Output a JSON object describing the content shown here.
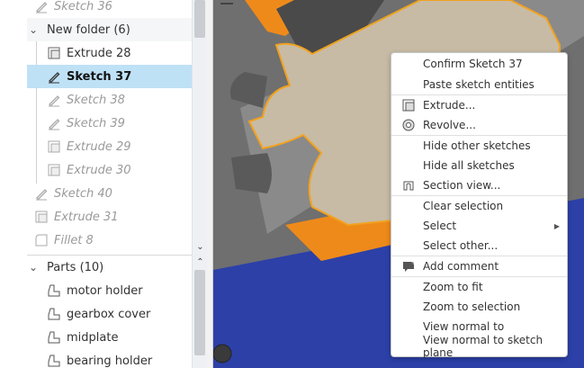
{
  "tree": {
    "items": [
      {
        "label": "Sketch 36",
        "icon": "sketch-icon",
        "dim": true
      },
      {
        "label": "New folder (6)",
        "icon": "chevron-down-icon",
        "folder": true
      },
      {
        "label": "Extrude 28",
        "icon": "extrude-icon"
      },
      {
        "label": "Sketch 37",
        "icon": "sketch-icon",
        "selected": true
      },
      {
        "label": "Sketch 38",
        "icon": "sketch-icon",
        "dim": true
      },
      {
        "label": "Sketch 39",
        "icon": "sketch-icon",
        "dim": true
      },
      {
        "label": "Extrude 29",
        "icon": "extrude-icon",
        "dim": true
      },
      {
        "label": "Extrude 30",
        "icon": "extrude-icon",
        "dim": true
      },
      {
        "label": "Sketch 40",
        "icon": "sketch-icon",
        "dim": true
      },
      {
        "label": "Extrude 31",
        "icon": "extrude-icon",
        "dim": true
      },
      {
        "label": "Fillet 8",
        "icon": "fillet-icon",
        "dim": true
      }
    ],
    "parts_header": "Parts (10)",
    "parts": [
      {
        "label": "motor holder",
        "icon": "part-icon"
      },
      {
        "label": "gearbox cover",
        "icon": "part-icon"
      },
      {
        "label": "midplate",
        "icon": "part-icon"
      },
      {
        "label": "bearing holder",
        "icon": "part-icon"
      }
    ]
  },
  "context_menu": {
    "items": [
      {
        "label": "Confirm Sketch 37"
      },
      {
        "label": "Paste sketch entities"
      },
      {
        "label": "Extrude...",
        "icon": "extrude-icon"
      },
      {
        "label": "Revolve...",
        "icon": "revolve-icon"
      },
      {
        "label": "Hide other sketches"
      },
      {
        "label": "Hide all sketches"
      },
      {
        "label": "Section view...",
        "icon": "section-view-icon"
      },
      {
        "label": "Clear selection"
      },
      {
        "label": "Select",
        "submenu": true
      },
      {
        "label": "Select other..."
      },
      {
        "label": "Add comment",
        "icon": "comment-icon"
      },
      {
        "label": "Zoom to fit"
      },
      {
        "label": "Zoom to selection"
      },
      {
        "label": "View normal to"
      },
      {
        "label": "View normal to sketch plane"
      }
    ]
  },
  "colors": {
    "selection": "#bfe1f6",
    "viewport_blue": "#2a3fa6",
    "part_orange": "#ee8a1a",
    "sketch_face": "#c8bba5",
    "gray_body": "#777777"
  }
}
